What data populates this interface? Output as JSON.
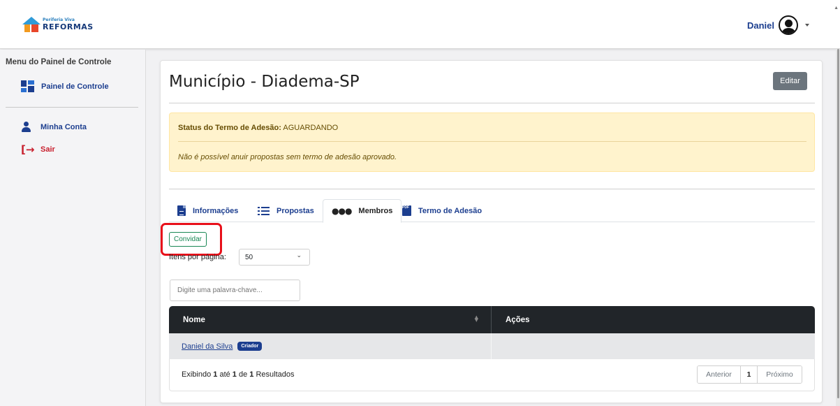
{
  "header": {
    "logo_small": "Periferia Viva",
    "logo_big": "REFORMAS",
    "user_name": "Daniel"
  },
  "sidebar": {
    "title": "Menu do Painel de Controle",
    "items": [
      {
        "label": "Painel de Controle",
        "icon": "dashboard-icon"
      },
      {
        "label": "Minha Conta",
        "icon": "person-icon"
      },
      {
        "label": "Sair",
        "icon": "logout-icon"
      }
    ]
  },
  "page": {
    "title": "Município - Diadema-SP",
    "edit_label": "Editar"
  },
  "alert": {
    "status_label": "Status do Termo de Adesão:",
    "status_value": " AGUARDANDO",
    "message": "Não é possível anuir propostas sem termo de adesão aprovado."
  },
  "tabs": [
    {
      "label": "Informações",
      "icon": "document-icon"
    },
    {
      "label": "Propostas",
      "icon": "list-icon"
    },
    {
      "label": "Membros",
      "icon": "users-icon",
      "active": true
    },
    {
      "label": "Termo de Adesão",
      "icon": "pdf-icon"
    }
  ],
  "members": {
    "invite_label": "Convidar",
    "per_page_label": "Itens por página:",
    "per_page_value": "50",
    "search_placeholder": "Digite uma palavra-chave...",
    "columns": [
      "Nome",
      "Ações"
    ],
    "rows": [
      {
        "name": "Daniel da Silva",
        "badge": "Criador"
      }
    ],
    "footer": {
      "prefix": "Exibindo ",
      "from": "1",
      "mid1": " até ",
      "to": "1",
      "mid2": " de ",
      "total": "1",
      "suffix": " Resultados"
    },
    "pagination": {
      "prev": "Anterior",
      "current": "1",
      "next": "Próximo"
    }
  },
  "colors": {
    "brand": "#1c3e8f",
    "danger": "#c8202e",
    "success": "#198754",
    "highlight": "#e8101a"
  }
}
